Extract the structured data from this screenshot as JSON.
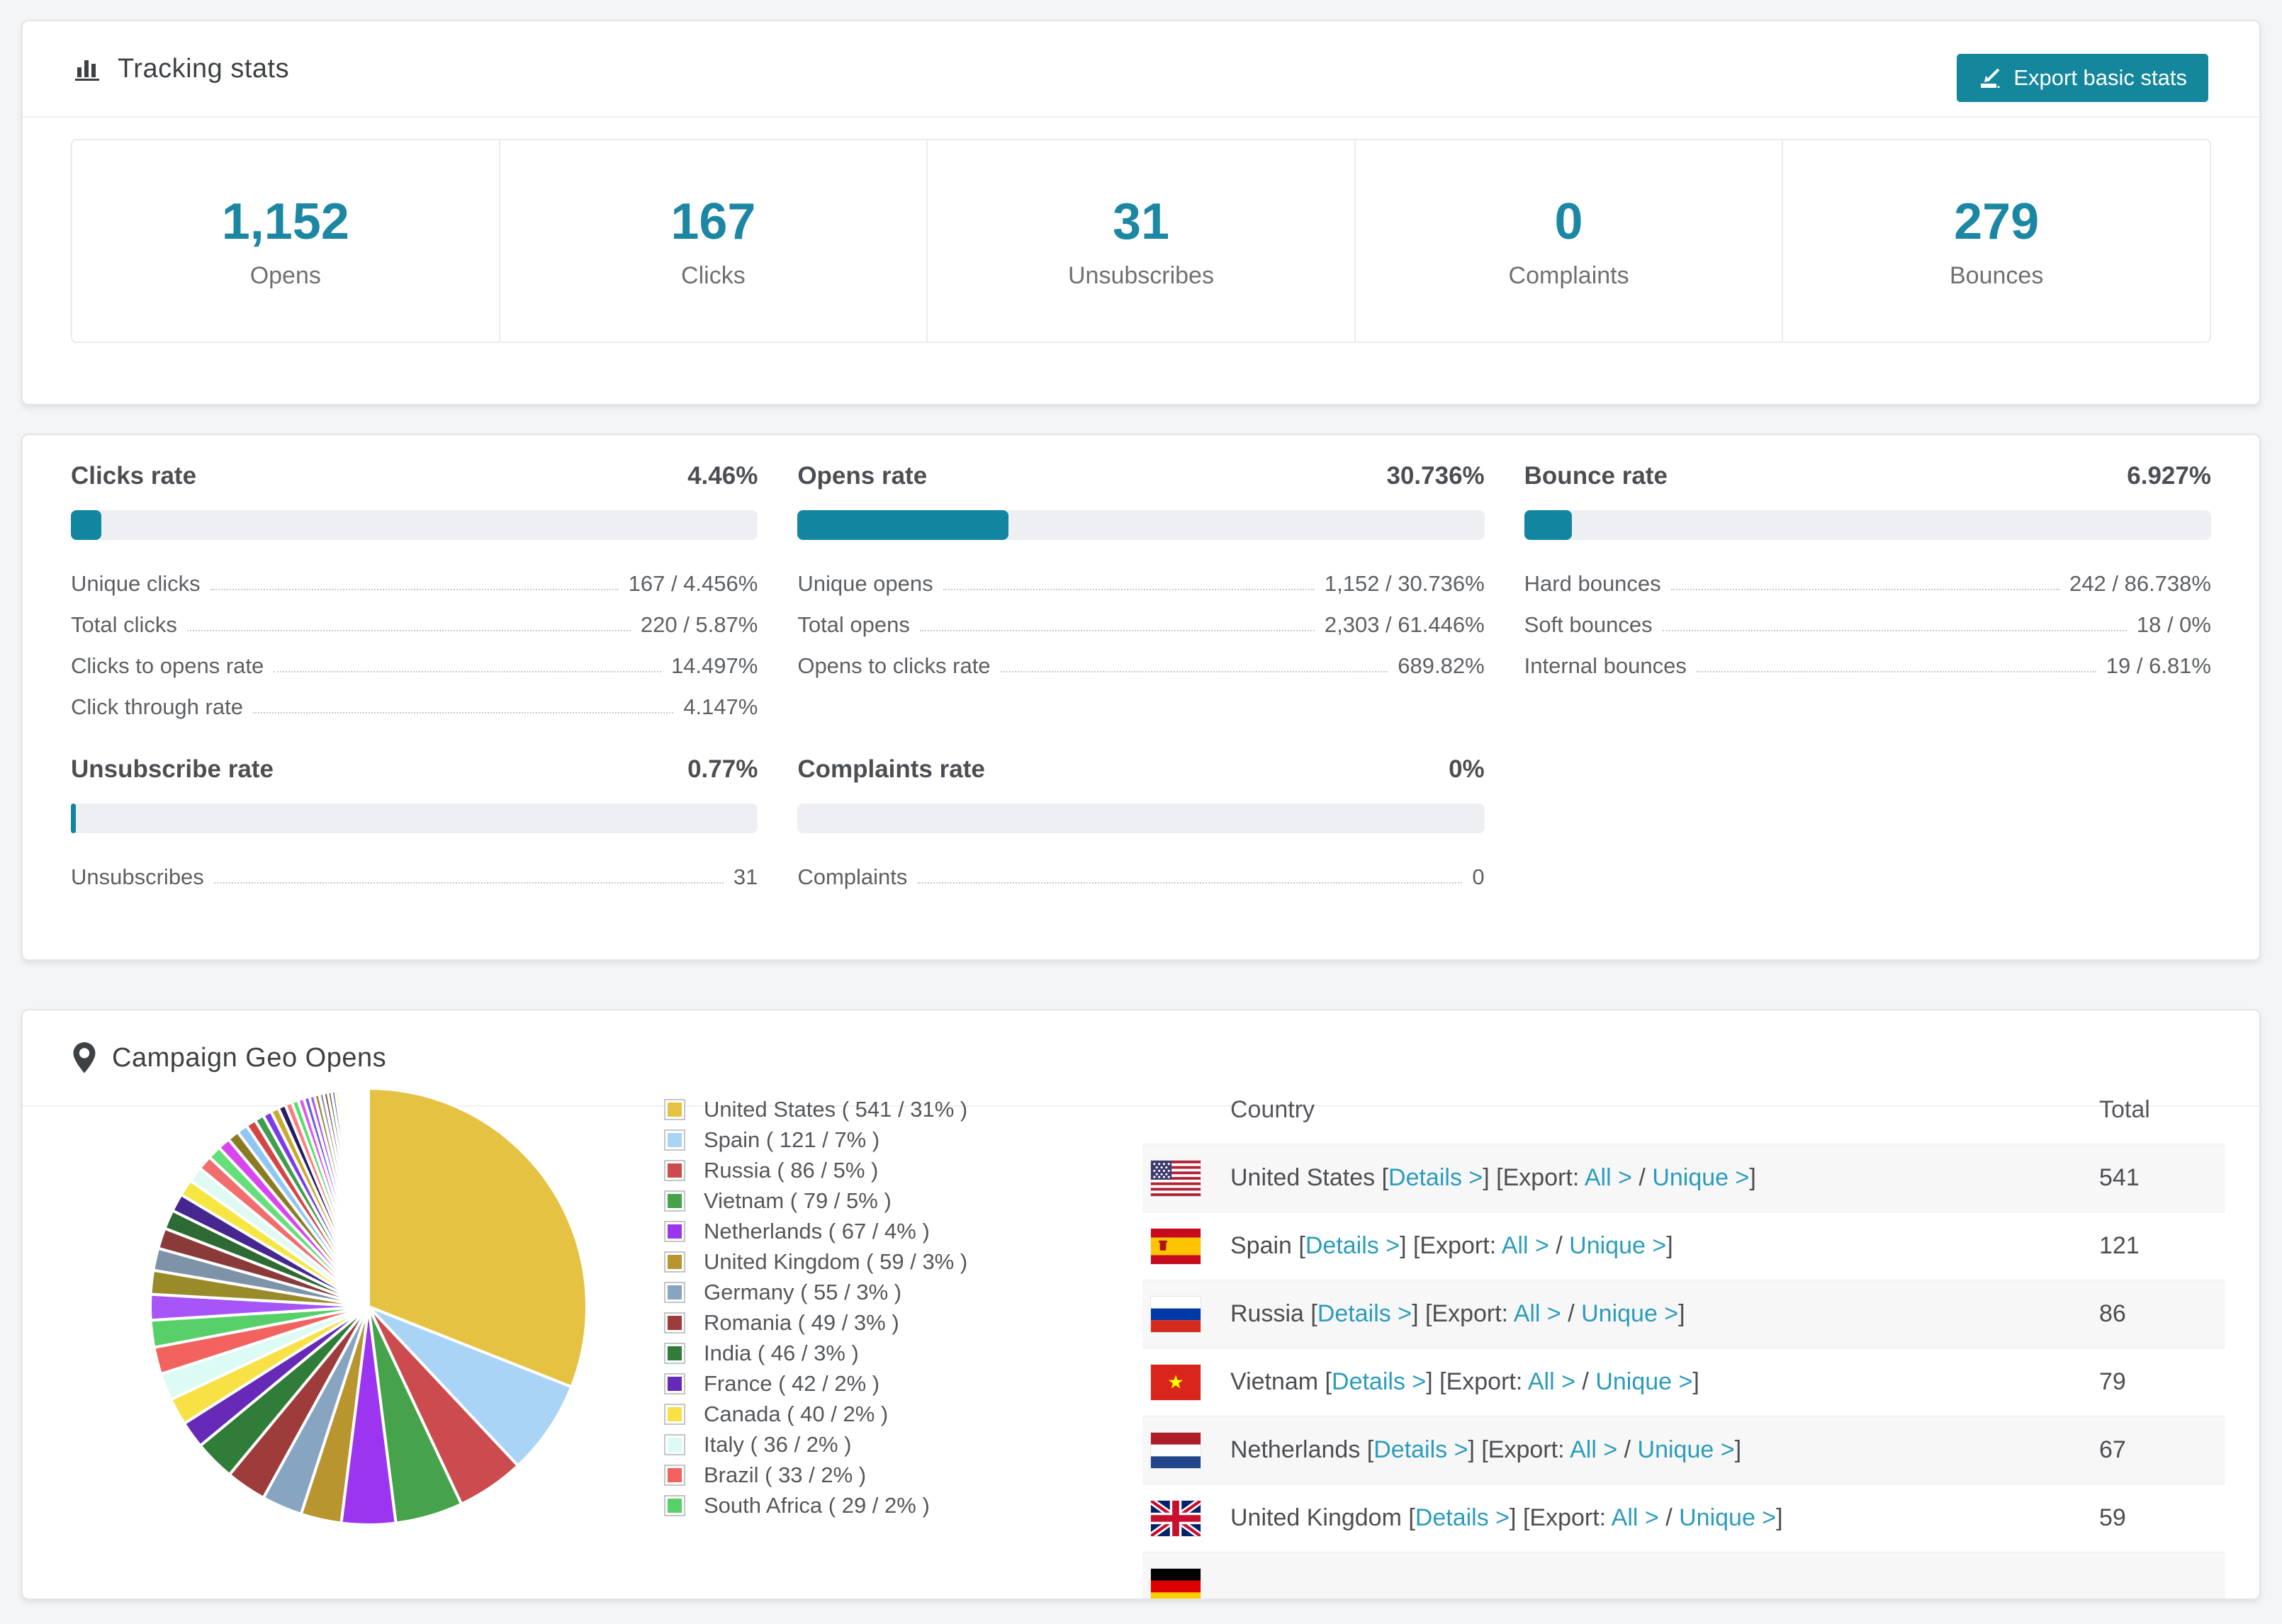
{
  "colors": {
    "accent": "#15879c",
    "accent_number": "#1b87a2",
    "bar_fill": "#1286a0",
    "bar_track": "#edeff2",
    "link": "#2b9cbd"
  },
  "tracking": {
    "title": "Tracking stats",
    "export_label": "Export basic stats",
    "summary": [
      {
        "value": "1,152",
        "label": "Opens"
      },
      {
        "value": "167",
        "label": "Clicks"
      },
      {
        "value": "31",
        "label": "Unsubscribes"
      },
      {
        "value": "0",
        "label": "Complaints"
      },
      {
        "value": "279",
        "label": "Bounces"
      }
    ]
  },
  "rates": [
    {
      "name": "Clicks rate",
      "value": "4.46%",
      "pct": 4.46,
      "rows": [
        [
          "Unique clicks",
          "167 / 4.456%"
        ],
        [
          "Total clicks",
          "220 / 5.87%"
        ],
        [
          "Clicks to opens rate",
          "14.497%"
        ],
        [
          "Click through rate",
          "4.147%"
        ]
      ]
    },
    {
      "name": "Opens rate",
      "value": "30.736%",
      "pct": 30.736,
      "rows": [
        [
          "Unique opens",
          "1,152 / 30.736%"
        ],
        [
          "Total opens",
          "2,303 / 61.446%"
        ],
        [
          "Opens to clicks rate",
          "689.82%"
        ]
      ]
    },
    {
      "name": "Bounce rate",
      "value": "6.927%",
      "pct": 6.927,
      "rows": [
        [
          "Hard bounces",
          "242 / 86.738%"
        ],
        [
          "Soft bounces",
          "18 / 0%"
        ],
        [
          "Internal bounces",
          "19 / 6.81%"
        ]
      ]
    },
    {
      "name": "Unsubscribe rate",
      "value": "0.77%",
      "pct": 0.77,
      "rows": [
        [
          "Unsubscribes",
          "31"
        ]
      ]
    },
    {
      "name": "Complaints rate",
      "value": "0%",
      "pct": 0,
      "rows": [
        [
          "Complaints",
          "0"
        ]
      ]
    }
  ],
  "geo": {
    "title": "Campaign Geo Opens",
    "col_country": "Country",
    "col_total": "Total",
    "links": {
      "details": "Details >",
      "export_prefix": "Export:",
      "all": "All >",
      "unique": "Unique >"
    },
    "rows": [
      {
        "flag": "us",
        "country": "United States",
        "total": "541"
      },
      {
        "flag": "es",
        "country": "Spain",
        "total": "121"
      },
      {
        "flag": "ru",
        "country": "Russia",
        "total": "86"
      },
      {
        "flag": "vn",
        "country": "Vietnam",
        "total": "79"
      },
      {
        "flag": "nl",
        "country": "Netherlands",
        "total": "67"
      },
      {
        "flag": "gb",
        "country": "United Kingdom",
        "total": "59"
      },
      {
        "flag": "de",
        "country": "Germany",
        "total": "",
        "partial": true
      }
    ]
  },
  "chart_data": {
    "type": "pie",
    "title": "Campaign Geo Opens",
    "legend_position": "right",
    "start_angle_deg": 0,
    "direction": "clockwise",
    "categories": [
      "United States",
      "Spain",
      "Russia",
      "Vietnam",
      "Netherlands",
      "United Kingdom",
      "Germany",
      "Romania",
      "India",
      "France",
      "Canada",
      "Italy",
      "Brazil",
      "South Africa"
    ],
    "values": [
      541,
      121,
      86,
      79,
      67,
      59,
      55,
      49,
      46,
      42,
      40,
      36,
      33,
      29
    ],
    "percents": [
      31,
      7,
      5,
      5,
      4,
      3,
      3,
      3,
      3,
      2,
      2,
      2,
      2,
      2
    ],
    "colors": [
      "#e6c243",
      "#a9d4f5",
      "#cb4b4e",
      "#47a24c",
      "#9b35f0",
      "#b8952f",
      "#87a5c1",
      "#9e3b3b",
      "#2f7d39",
      "#6629b8",
      "#f7e145",
      "#dcfbf5",
      "#f2635f",
      "#57d069"
    ],
    "legend_format": "{name} ( {value} / {pct}% )",
    "others_percent": 26,
    "tail_slice_count": 44,
    "tail_decay": 0.93,
    "tail_palette": [
      "#a855f7",
      "#9a8b2a",
      "#7d93a8",
      "#8b3a3a",
      "#2e6b34",
      "#45278f",
      "#f5e642",
      "#dff9f5",
      "#f26d6d",
      "#66de7a",
      "#d946ef",
      "#8a7a22",
      "#8fc7f2",
      "#d64545",
      "#3f9e4d",
      "#7c3aed",
      "#c9a92e",
      "#281c63",
      "#ff7b7b",
      "#56e06b",
      "#e055f0",
      "#6b5de8"
    ]
  }
}
